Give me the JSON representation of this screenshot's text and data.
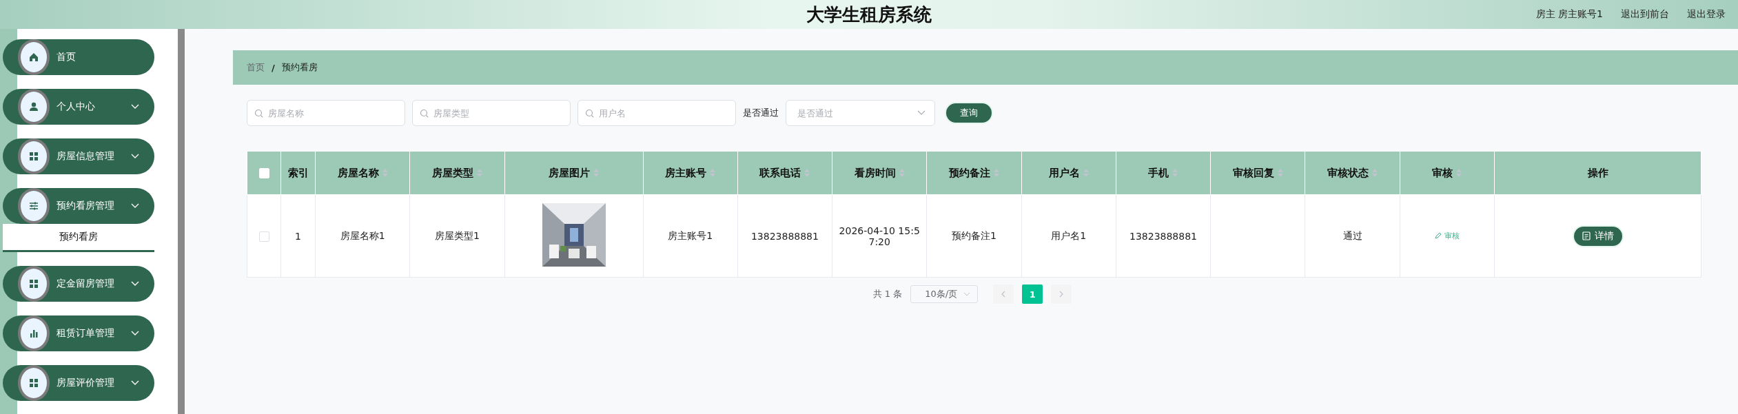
{
  "header": {
    "title": "大学生租房系统",
    "user_info": "房主 房主账号1",
    "links": [
      "退出到前台",
      "退出登录"
    ]
  },
  "sidebar": {
    "items": [
      {
        "label": "首页",
        "kind": "link"
      },
      {
        "label": "个人中心",
        "kind": "group"
      },
      {
        "label": "房屋信息管理",
        "kind": "group"
      },
      {
        "label": "预约看房管理",
        "kind": "group",
        "children": [
          {
            "label": "预约看房",
            "selected": true
          }
        ]
      },
      {
        "label": "定金留房管理",
        "kind": "group"
      },
      {
        "label": "租赁订单管理",
        "kind": "group"
      },
      {
        "label": "房屋评价管理",
        "kind": "group"
      }
    ]
  },
  "breadcrumb": {
    "items": [
      "首页",
      "预约看房"
    ],
    "separator": "/"
  },
  "search": {
    "fields": [
      {
        "placeholder": "房屋名称"
      },
      {
        "placeholder": "房屋类型"
      },
      {
        "placeholder": "用户名"
      }
    ],
    "select_label": "是否通过",
    "select": {
      "placeholder": "是否通过"
    },
    "button": "查询"
  },
  "table": {
    "select_all": {
      "checked": false
    },
    "columns": [
      {
        "label": "索引",
        "sortable": false
      },
      {
        "label": "房屋名称",
        "sortable": true
      },
      {
        "label": "房屋类型",
        "sortable": true
      },
      {
        "label": "房屋图片",
        "sortable": true
      },
      {
        "label": "房主账号",
        "sortable": true
      },
      {
        "label": "联系电话",
        "sortable": true
      },
      {
        "label": "看房时间",
        "sortable": true
      },
      {
        "label": "预约备注",
        "sortable": true
      },
      {
        "label": "用户名",
        "sortable": true
      },
      {
        "label": "手机",
        "sortable": true
      },
      {
        "label": "审核回复",
        "sortable": true
      },
      {
        "label": "审核状态",
        "sortable": true
      },
      {
        "label": "审核",
        "sortable": true
      },
      {
        "label": "操作",
        "sortable": false
      }
    ],
    "rows": [
      {
        "checked": false,
        "index": "1",
        "house_name": "房屋名称1",
        "house_type": "房屋类型1",
        "owner": "房主账号1",
        "phone": "13823888881",
        "time": "2026-04-10 15:57:20",
        "note": "预约备注1",
        "user": "用户名1",
        "mobile": "13823888881",
        "status": "通过",
        "audit_link": "审核",
        "action": "详情"
      }
    ]
  },
  "pagination": {
    "total": "共 1 条",
    "page_size": "10条/页",
    "prev": {
      "disabled": true
    },
    "pages": [
      {
        "label": "1",
        "selected": true
      }
    ],
    "next": {
      "disabled": true
    }
  }
}
